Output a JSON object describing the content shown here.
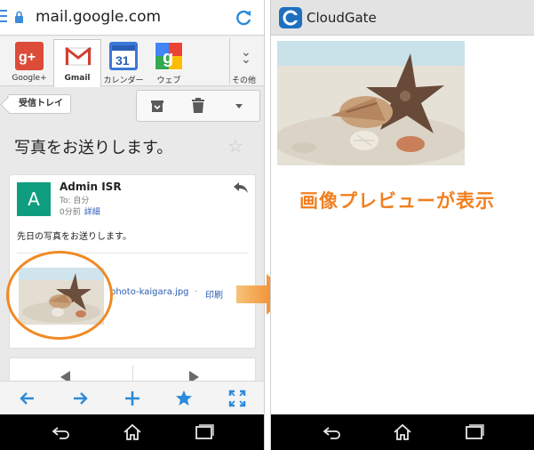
{
  "browser": {
    "url": "mail.google.com"
  },
  "apps": [
    {
      "label": "Google+",
      "icon": "google-plus-icon",
      "color": "#dd4b39"
    },
    {
      "label": "Gmail",
      "icon": "gmail-icon",
      "color": "#d23f31"
    },
    {
      "label": "カレンダー",
      "icon": "calendar-icon",
      "color": "#3a79d6"
    },
    {
      "label": "ウェブ",
      "icon": "web-search-icon",
      "color": "#4285f4"
    },
    {
      "label": "その他",
      "icon": "more-chevron-icon"
    }
  ],
  "mail": {
    "back_label": "受信トレイ",
    "subject": "写真をお送りします。",
    "avatar_letter": "A",
    "sender": "Admin ISR",
    "to": "To: 自分",
    "time": "0分前",
    "details_link": "詳細",
    "body": "先日の写真をお送りします。",
    "attachment_name": "photo-kaigara.jpg",
    "attachment_sep": "·",
    "print_link": "印刷"
  },
  "right": {
    "app_title": "CloudGate",
    "caption": "画像プレビューが表示"
  },
  "colors": {
    "accent_blue": "#2c8ad8",
    "highlight_orange": "#f08a25",
    "avatar_green": "#0f9d80",
    "caption_orange": "#f0801f"
  }
}
